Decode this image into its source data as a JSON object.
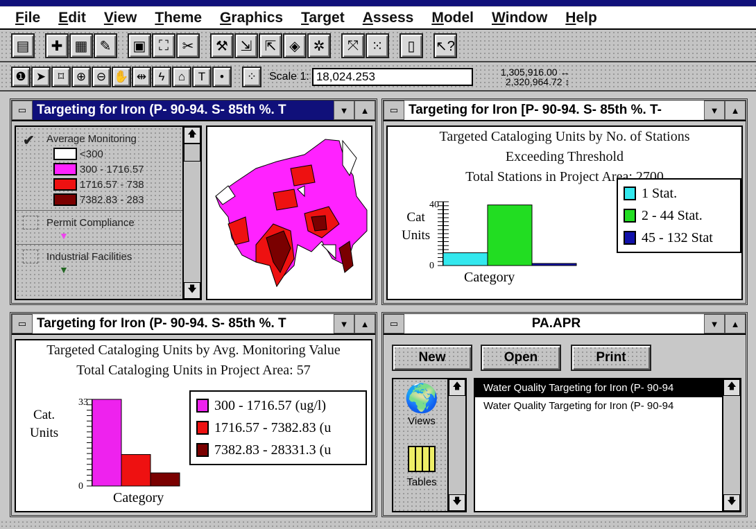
{
  "menu": [
    "File",
    "Edit",
    "View",
    "Theme",
    "Graphics",
    "Target",
    "Assess",
    "Model",
    "Window",
    "Help"
  ],
  "toolbar1": [
    "save-icon",
    "add-theme-icon",
    "theme-properties-icon",
    "edit-legend-icon",
    "table-icon",
    "find-icon",
    "query-icon",
    "hammer-icon",
    "import-icon",
    "export-icon",
    "locate-icon",
    "zoom-full-icon",
    "zoom-active-icon",
    "select-all-icon",
    "layout-icon",
    "help-pointer-icon"
  ],
  "toolbar2": [
    "identify-icon",
    "pointer-icon",
    "vertex-edit-icon",
    "zoom-in-icon",
    "zoom-out-icon",
    "pan-icon",
    "measure-icon",
    "hot-link-icon",
    "label-icon",
    "text-icon",
    "draw-point-icon",
    "snap-icon"
  ],
  "scale": {
    "label": "Scale 1:",
    "value": "18,024.253"
  },
  "coords": {
    "x": "1,305,916.00",
    "y": "2,320,964.72"
  },
  "view_window": {
    "title": "Targeting for Iron (P- 90-94. S- 85th %. T",
    "themes": [
      {
        "name": "Average Monitoring",
        "checked": true,
        "classes": [
          {
            "label": "<300",
            "color": "#ffffff"
          },
          {
            "label": "300 - 1716.57",
            "color": "#ff22ff"
          },
          {
            "label": "1716.57 - 738",
            "color": "#ee1111"
          },
          {
            "label": "7382.83 - 283",
            "color": "#7a0000"
          }
        ]
      },
      {
        "name": "Permit Compliance",
        "checked": false,
        "symbol_color": "#ee44ee"
      },
      {
        "name": "Industrial Facilities",
        "checked": false,
        "symbol_color": "#226622"
      }
    ]
  },
  "chart1_window": {
    "title": "Targeting for Iron [P- 90-94. S- 85th %. T-"
  },
  "chart2_window": {
    "title": "Targeting for Iron (P- 90-94. S- 85th %. T"
  },
  "project_window": {
    "title": "PA.APR",
    "buttons": [
      "New",
      "Open",
      "Print"
    ],
    "doc_types": [
      {
        "label": "Views",
        "icon": "views-icon"
      },
      {
        "label": "Tables",
        "icon": "tables-icon"
      }
    ],
    "items": [
      {
        "label": "Water Quality Targeting for Iron (P- 90-94",
        "selected": true
      },
      {
        "label": "Water Quality Targeting for Iron (P- 90-94",
        "selected": false
      }
    ]
  },
  "chart_data": [
    {
      "type": "bar",
      "title": [
        "Targeted Cataloging Units by No. of Stations",
        "Exceeding Threshold",
        "Total Stations in Project Area: 2700"
      ],
      "xlabel": "Category",
      "ylabel": [
        "Cat",
        "Units"
      ],
      "ylim": [
        0,
        40
      ],
      "series": [
        {
          "name": "1 Stat.",
          "value": 8,
          "color": "#33e8ee"
        },
        {
          "name": "2 - 44 Stat.",
          "value": 38,
          "color": "#22dd22"
        },
        {
          "name": "45 - 132 Stat",
          "value": 1,
          "color": "#1111aa"
        }
      ],
      "legend": "right"
    },
    {
      "type": "bar",
      "title": [
        "Targeted Cataloging Units by Avg. Monitoring Value",
        "Total Cataloging Units in Project Area: 57"
      ],
      "xlabel": "Category",
      "ylabel": [
        "Cat.",
        "Units"
      ],
      "ylim": [
        0,
        33
      ],
      "series": [
        {
          "name": "300 - 1716.57 (ug/l)",
          "value": 33,
          "color": "#ee22ee"
        },
        {
          "name": "1716.57 - 7382.83 (u",
          "value": 12,
          "color": "#ee1111"
        },
        {
          "name": "7382.83 - 28331.3 (u",
          "value": 5,
          "color": "#7a0000"
        }
      ],
      "legend": "right"
    }
  ]
}
